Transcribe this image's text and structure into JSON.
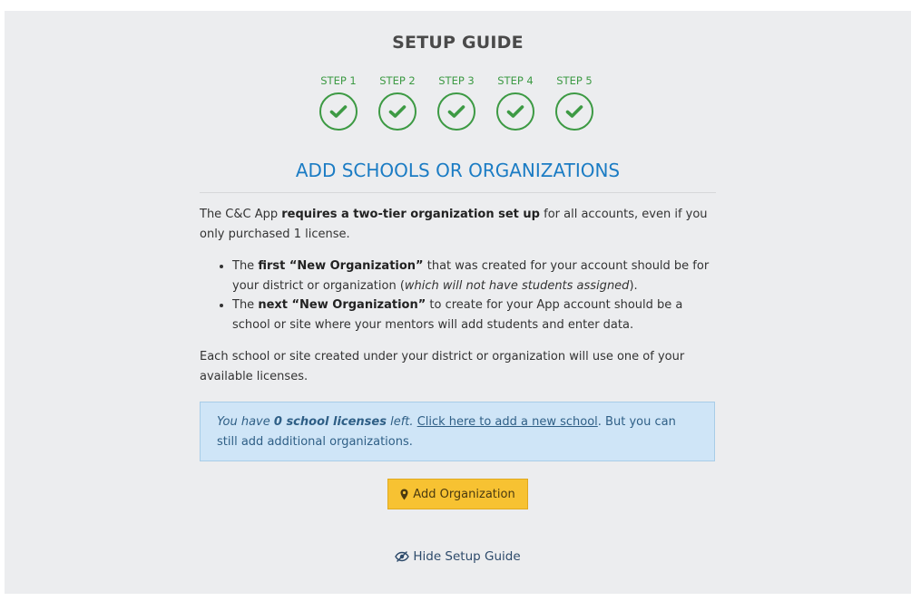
{
  "guide": {
    "title": "SETUP GUIDE",
    "steps": [
      {
        "label": "STEP 1",
        "status": "complete"
      },
      {
        "label": "STEP 2",
        "status": "complete"
      },
      {
        "label": "STEP 3",
        "status": "complete"
      },
      {
        "label": "STEP 4",
        "status": "complete"
      },
      {
        "label": "STEP 5",
        "status": "complete"
      }
    ]
  },
  "section": {
    "title": "ADD SCHOOLS OR ORGANIZATIONS",
    "intro": {
      "before": "The C&C App ",
      "bold": "requires a two-tier organization set up",
      "after": " for all accounts, even if you only purchased 1 license."
    },
    "bullets": [
      {
        "pre": "The ",
        "bold1": "first",
        "bold2": " “New Organization”",
        "mid": " that was created for your account should be for your district or organization (",
        "italic": "which will not have students assigned",
        "post": ")."
      },
      {
        "pre": "The ",
        "bold1": "next",
        "bold2": " “New Organization”",
        "mid": " to create for your App account should be a school or site where your mentors will add students and enter data.",
        "italic": "",
        "post": ""
      }
    ],
    "outro": "Each school or site created under your district or organization will use one of your available licenses."
  },
  "notice": {
    "prefix": "You have ",
    "count": "0 school licenses",
    "suffix": " left.",
    "link": "Click here to add a new school",
    "rest": ". But you can still add additional organizations."
  },
  "actions": {
    "add_label": "Add Organization",
    "hide_label": "Hide Setup Guide"
  },
  "colors": {
    "step_green": "#3d9a44",
    "title_blue": "#1b7cc4",
    "button_yellow": "#f7c232",
    "notice_bg": "#cfe5f7"
  },
  "icons": {
    "step": "check-icon",
    "add": "map-marker-icon",
    "hide": "eye-slash-icon"
  }
}
